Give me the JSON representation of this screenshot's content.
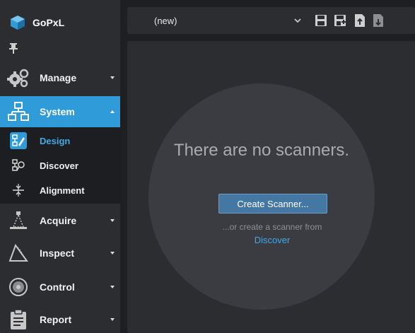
{
  "brand": {
    "name": "GoPxL"
  },
  "sidebar": {
    "items": [
      {
        "label": "Manage",
        "icon": "gears-icon"
      },
      {
        "label": "System",
        "icon": "network-icon",
        "active": true
      },
      {
        "label": "Acquire",
        "icon": "scanner-icon"
      },
      {
        "label": "Inspect",
        "icon": "inspect-icon"
      },
      {
        "label": "Control",
        "icon": "control-icon"
      },
      {
        "label": "Report",
        "icon": "clipboard-icon"
      }
    ],
    "system_subitems": [
      {
        "label": "Design",
        "icon": "design-icon",
        "active": true
      },
      {
        "label": "Discover",
        "icon": "discover-icon"
      },
      {
        "label": "Alignment",
        "icon": "alignment-icon"
      }
    ]
  },
  "toolbar": {
    "job_select_value": "(new)",
    "buttons": [
      "save-icon",
      "save-as-icon",
      "import-icon",
      "export-icon"
    ]
  },
  "main": {
    "empty_title": "There are no scanners.",
    "create_button": "Create Scanner...",
    "or_text": "...or create a scanner from",
    "discover_link": "Discover"
  },
  "colors": {
    "accent": "#2f9bd8",
    "link": "#3fa9ea",
    "panel": "#2b2d31",
    "background": "#1e1f22",
    "button": "#4477a2"
  }
}
